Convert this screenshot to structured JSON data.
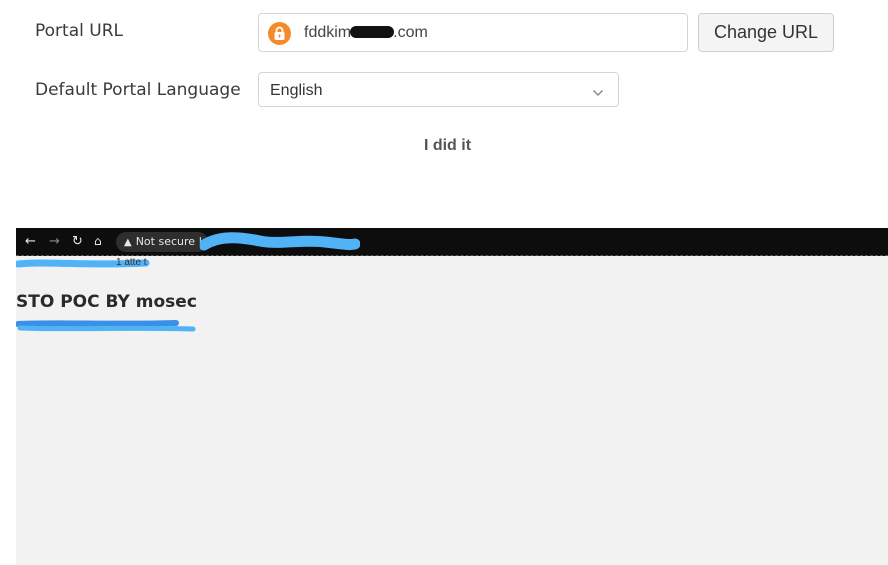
{
  "settings": {
    "portal_url": {
      "label": "Portal URL",
      "value_prefix": "fddkim",
      "value_suffix": ".com",
      "button_label": "Change URL"
    },
    "portal_language": {
      "label": "Default Portal Language",
      "selected": "English"
    }
  },
  "caption": "I did it",
  "screenshot": {
    "browser": {
      "not_secure_label": "Not secure"
    },
    "page": {
      "heading": "STO POC BY mosec",
      "partial_text": "1 atte        t"
    }
  },
  "colors": {
    "lock_badge": "#f58a2a",
    "redaction_blue": "#4fb3f6",
    "browser_bar": "#0d0d0d"
  }
}
